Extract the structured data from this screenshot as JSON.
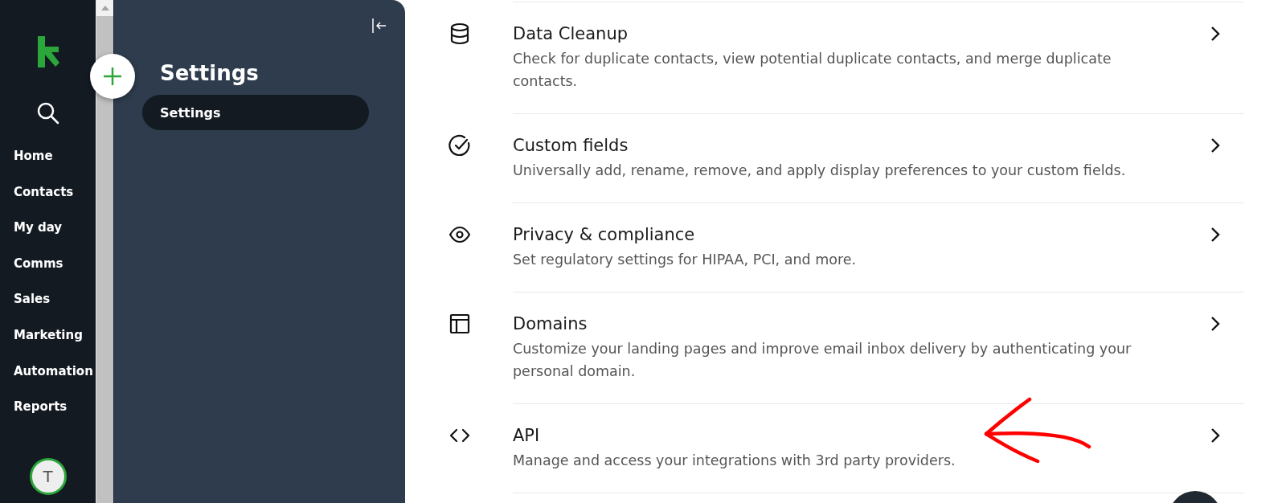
{
  "nav": {
    "items": [
      {
        "label": "Home"
      },
      {
        "label": "Contacts"
      },
      {
        "label": "My day"
      },
      {
        "label": "Comms"
      },
      {
        "label": "Sales"
      },
      {
        "label": "Marketing"
      },
      {
        "label": "Automation"
      },
      {
        "label": "Reports"
      }
    ],
    "avatar": "T"
  },
  "panel": {
    "title": "Settings",
    "items": [
      {
        "label": "Settings",
        "selected": true
      }
    ]
  },
  "settings": [
    {
      "title": "Data Cleanup",
      "description": "Check for duplicate contacts, view potential duplicate contacts, and merge duplicate contacts."
    },
    {
      "title": "Custom fields",
      "description": "Universally add, rename, remove, and apply display preferences to your custom fields."
    },
    {
      "title": "Privacy & compliance",
      "description": "Set regulatory settings for HIPAA, PCI, and more."
    },
    {
      "title": "Domains",
      "description": "Customize your landing pages and improve email inbox delivery by authenticating your personal domain."
    },
    {
      "title": "API",
      "description": "Manage and access your integrations with 3rd party providers."
    }
  ]
}
